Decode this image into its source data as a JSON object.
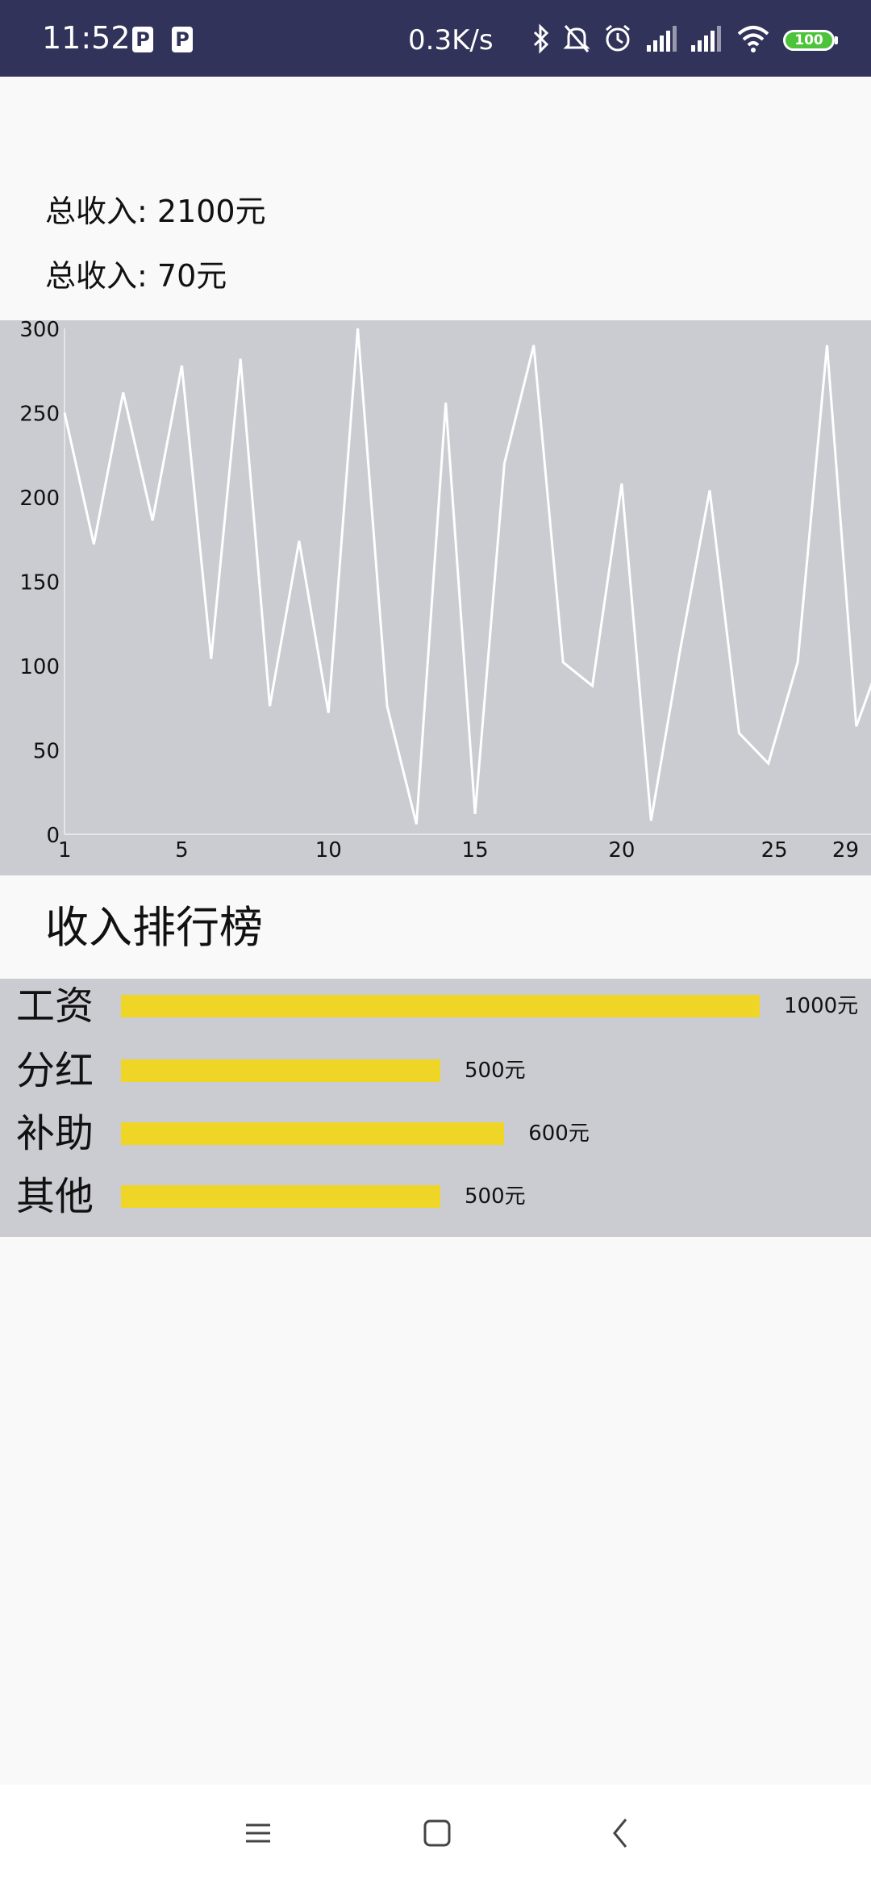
{
  "status_bar": {
    "time": "11:52",
    "notification_icons": [
      "parking-app-icon",
      "parking-app-icon"
    ],
    "network_speed": "0.3K/s",
    "icons": [
      "bluetooth-icon",
      "mute-icon",
      "alarm-icon",
      "signal-icon",
      "signal-icon",
      "wifi-icon"
    ],
    "battery": "100",
    "battery_color": "#4cc33a",
    "background_color": "#32335a"
  },
  "summary": {
    "income_label": "总收入:",
    "income_value": "2100元",
    "second_label": "总收入:",
    "second_value": "70元"
  },
  "chart_data": {
    "type": "line",
    "x": [
      1,
      2,
      3,
      4,
      5,
      6,
      7,
      8,
      9,
      10,
      11,
      12,
      13,
      14,
      15,
      16,
      17,
      18,
      19,
      20,
      21,
      22,
      23,
      24,
      25,
      26,
      27,
      28,
      29
    ],
    "series": [
      {
        "values": [
          250,
          172,
          262,
          186,
          278,
          104,
          282,
          76,
          174,
          72,
          300,
          76,
          6,
          256,
          12,
          220,
          290,
          102,
          88,
          208,
          8,
          110,
          204,
          60,
          42,
          102,
          290,
          64,
          112
        ]
      }
    ],
    "xticks": [
      "1",
      "5",
      "10",
      "15",
      "20",
      "25",
      "29"
    ],
    "xtick_values": [
      1,
      5,
      10,
      15,
      20,
      25,
      29
    ],
    "yticks": [
      "0",
      "50",
      "100",
      "150",
      "200",
      "250",
      "300"
    ],
    "ylim": [
      0,
      300
    ],
    "xlim": [
      1,
      28.5
    ],
    "line_color": "#ffffff",
    "background": "#cbcbd2",
    "grid": false
  },
  "ranking": {
    "title": "收入排行榜",
    "bar_color": "#efd626",
    "items": [
      {
        "name": "工资",
        "value": 1000,
        "amount": "1000元"
      },
      {
        "name": "分红",
        "value": 500,
        "amount": "500元"
      },
      {
        "name": "补助",
        "value": 600,
        "amount": "600元"
      },
      {
        "name": "其他",
        "value": 500,
        "amount": "500元"
      }
    ]
  },
  "nav_bar": {
    "icons": [
      "menu-icon",
      "home-icon",
      "back-icon"
    ]
  }
}
